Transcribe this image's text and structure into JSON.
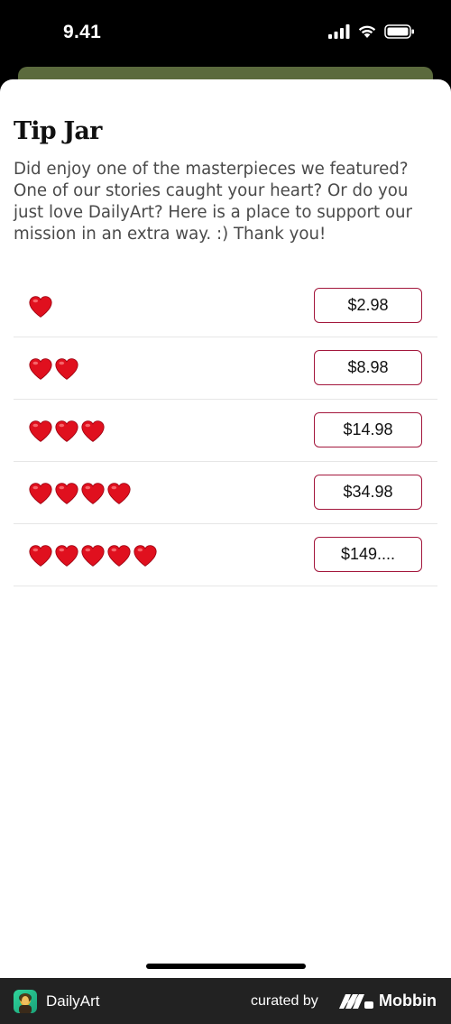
{
  "status_bar": {
    "time": "9.41",
    "signal_icon": "signal-icon",
    "wifi_icon": "wifi-icon",
    "battery_icon": "battery-icon"
  },
  "sheet": {
    "title": "Tip Jar",
    "description": "Did enjoy one of the masterpieces we featured? One of our stories caught your heart? Or do you just love DailyArt? Here is a place to support our mission in an extra way. :) Thank you!"
  },
  "tips": [
    {
      "hearts": 1,
      "price": "$2.98"
    },
    {
      "hearts": 2,
      "price": "$8.98"
    },
    {
      "hearts": 3,
      "price": "$14.98"
    },
    {
      "hearts": 4,
      "price": "$34.98"
    },
    {
      "hearts": 5,
      "price": "$149...."
    }
  ],
  "colors": {
    "accent": "#a3173c",
    "heart": "#e0101e",
    "footer_bg": "#222222"
  },
  "footer": {
    "app_name": "DailyArt",
    "curated_by": "curated by",
    "brand": "Mobbin"
  }
}
